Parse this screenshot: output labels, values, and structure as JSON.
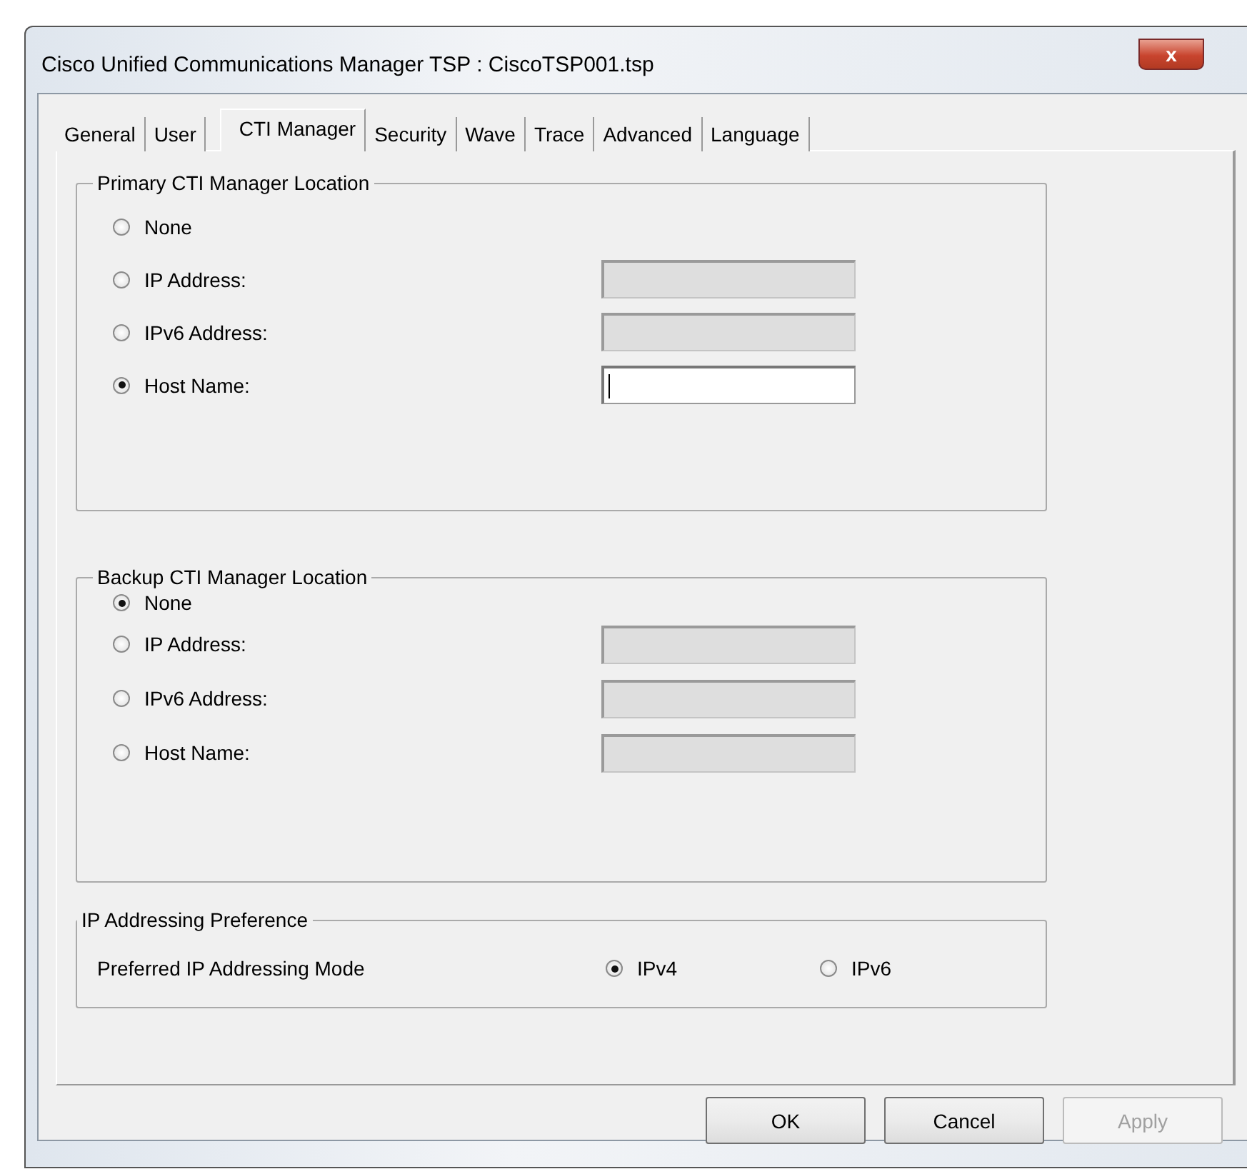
{
  "window": {
    "title": "Cisco Unified Communications Manager  TSP : CiscoTSP001.tsp",
    "close": "x"
  },
  "tabs": [
    {
      "label": "General",
      "selected": false
    },
    {
      "label": "User",
      "selected": false
    },
    {
      "label": "CTI Manager",
      "selected": true
    },
    {
      "label": "Security",
      "selected": false
    },
    {
      "label": "Wave",
      "selected": false
    },
    {
      "label": "Trace",
      "selected": false
    },
    {
      "label": "Advanced",
      "selected": false
    },
    {
      "label": "Language",
      "selected": false
    }
  ],
  "groups": [
    {
      "title": "Primary CTI Manager Location",
      "options": [
        {
          "label": "None",
          "selected": false
        },
        {
          "label": "IP Address:",
          "selected": false,
          "field": {
            "disabled": true,
            "focused": false
          }
        },
        {
          "label": "IPv6 Address:",
          "selected": false,
          "field": {
            "disabled": true,
            "focused": false
          }
        },
        {
          "label": "Host Name:",
          "selected": true,
          "field": {
            "disabled": false,
            "focused": true
          }
        }
      ]
    },
    {
      "title": "Backup CTI Manager Location",
      "options": [
        {
          "label": "None",
          "selected": true
        },
        {
          "label": "IP Address:",
          "selected": false,
          "field": {
            "disabled": true,
            "focused": false
          }
        },
        {
          "label": "IPv6 Address:",
          "selected": false,
          "field": {
            "disabled": true,
            "focused": false
          }
        },
        {
          "label": "Host Name:",
          "selected": false,
          "field": {
            "disabled": true,
            "focused": false
          }
        }
      ]
    }
  ],
  "preference": {
    "title": "IP Addressing Preference",
    "label": "Preferred IP Addressing Mode",
    "options": [
      {
        "label": "IPv4",
        "selected": true
      },
      {
        "label": "IPv6",
        "selected": false
      }
    ]
  },
  "buttons": [
    {
      "label": "OK",
      "disabled": false
    },
    {
      "label": "Cancel",
      "disabled": false
    },
    {
      "label": "Apply",
      "disabled": true
    }
  ]
}
